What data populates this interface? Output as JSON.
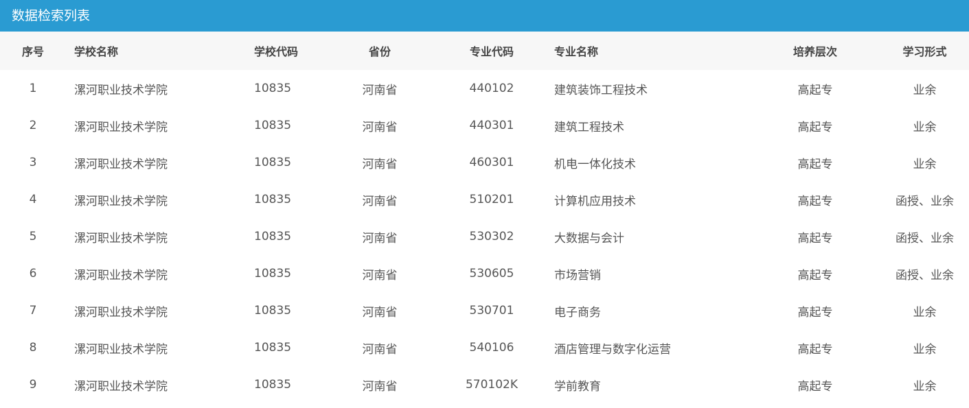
{
  "title": "数据检索列表",
  "columns": {
    "idx": "序号",
    "school_name": "学校名称",
    "school_code": "学校代码",
    "province": "省份",
    "major_code": "专业代码",
    "major_name": "专业名称",
    "level": "培养层次",
    "study_form": "学习形式"
  },
  "rows": [
    {
      "idx": "1",
      "school_name": "漯河职业技术学院",
      "school_code": "10835",
      "province": "河南省",
      "major_code": "440102",
      "major_name": "建筑装饰工程技术",
      "level": "高起专",
      "study_form": "业余"
    },
    {
      "idx": "2",
      "school_name": "漯河职业技术学院",
      "school_code": "10835",
      "province": "河南省",
      "major_code": "440301",
      "major_name": "建筑工程技术",
      "level": "高起专",
      "study_form": "业余"
    },
    {
      "idx": "3",
      "school_name": "漯河职业技术学院",
      "school_code": "10835",
      "province": "河南省",
      "major_code": "460301",
      "major_name": "机电一体化技术",
      "level": "高起专",
      "study_form": "业余"
    },
    {
      "idx": "4",
      "school_name": "漯河职业技术学院",
      "school_code": "10835",
      "province": "河南省",
      "major_code": "510201",
      "major_name": "计算机应用技术",
      "level": "高起专",
      "study_form": "函授、业余"
    },
    {
      "idx": "5",
      "school_name": "漯河职业技术学院",
      "school_code": "10835",
      "province": "河南省",
      "major_code": "530302",
      "major_name": "大数据与会计",
      "level": "高起专",
      "study_form": "函授、业余"
    },
    {
      "idx": "6",
      "school_name": "漯河职业技术学院",
      "school_code": "10835",
      "province": "河南省",
      "major_code": "530605",
      "major_name": "市场营销",
      "level": "高起专",
      "study_form": "函授、业余"
    },
    {
      "idx": "7",
      "school_name": "漯河职业技术学院",
      "school_code": "10835",
      "province": "河南省",
      "major_code": "530701",
      "major_name": "电子商务",
      "level": "高起专",
      "study_form": "业余"
    },
    {
      "idx": "8",
      "school_name": "漯河职业技术学院",
      "school_code": "10835",
      "province": "河南省",
      "major_code": "540106",
      "major_name": "酒店管理与数字化运营",
      "level": "高起专",
      "study_form": "业余"
    },
    {
      "idx": "9",
      "school_name": "漯河职业技术学院",
      "school_code": "10835",
      "province": "河南省",
      "major_code": "570102K",
      "major_name": "学前教育",
      "level": "高起专",
      "study_form": "业余"
    }
  ]
}
